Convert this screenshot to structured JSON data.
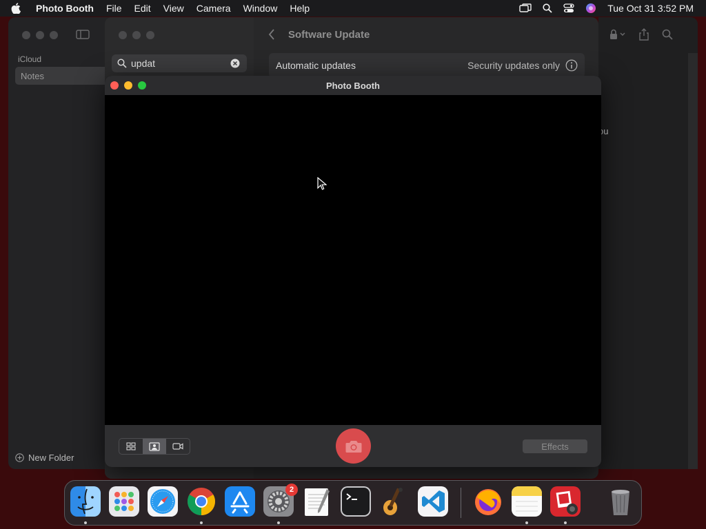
{
  "menubar": {
    "app_name": "Photo Booth",
    "items": [
      "File",
      "Edit",
      "View",
      "Camera",
      "Window",
      "Help"
    ],
    "datetime": "Tue Oct 31  3:52 PM"
  },
  "notes": {
    "section": "iCloud",
    "folder": "Notes",
    "new_folder": "New Folder",
    "peek_text": "ou"
  },
  "settings": {
    "search_value": "updat",
    "title": "Software Update",
    "row_label": "Automatic updates",
    "row_value": "Security updates only"
  },
  "photobooth": {
    "title": "Photo Booth",
    "effects_label": "Effects"
  },
  "dock": {
    "settings_badge": "2",
    "apps": [
      "Finder",
      "Launchpad",
      "Safari",
      "Chrome",
      "App Store",
      "System Settings",
      "TextEdit",
      "Terminal",
      "GarageBand",
      "VS Code",
      "Firefox",
      "Notes",
      "Photo Booth",
      "Trash"
    ]
  },
  "colors": {
    "close": "#ff5f57",
    "minimize": "#febc2e",
    "zoom": "#28c840",
    "shutter": "#d94b4d"
  }
}
